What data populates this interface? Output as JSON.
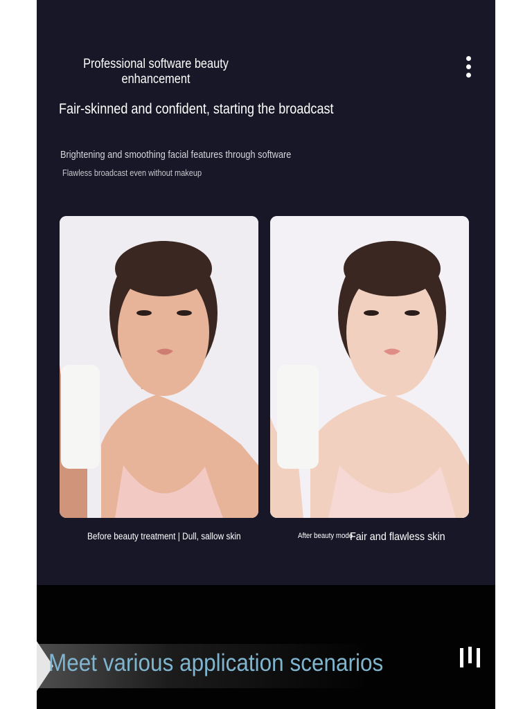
{
  "header": {
    "title": "Professional software beauty enhancement",
    "headline": "Fair-skinned and confident, starting the broadcast",
    "description": "Brightening and smoothing facial features through software",
    "subdescription": "Flawless broadcast even without makeup",
    "menu_icon": "more-vertical-icon"
  },
  "comparison": {
    "before": {
      "caption": "Before beauty treatment | Dull, sallow skin",
      "skin_color": "#e7b49a",
      "shadow_color": "#cf9479"
    },
    "after": {
      "caption_small": "After beauty mode",
      "caption_large": "Fair and flawless skin",
      "skin_color": "#f2d0c0",
      "shadow_color": "#e3b39f"
    }
  },
  "footer": {
    "scenarios_label": "Meet various application scenarios",
    "scenarios_color": "#7fb5cf",
    "pause_icon": "pause-bars-icon"
  },
  "colors": {
    "panel": "#171727",
    "bottom": "#020203",
    "hair": "#3a2721",
    "top_fabric": "#f3c9c3",
    "bottle": "#f6f6f4"
  }
}
